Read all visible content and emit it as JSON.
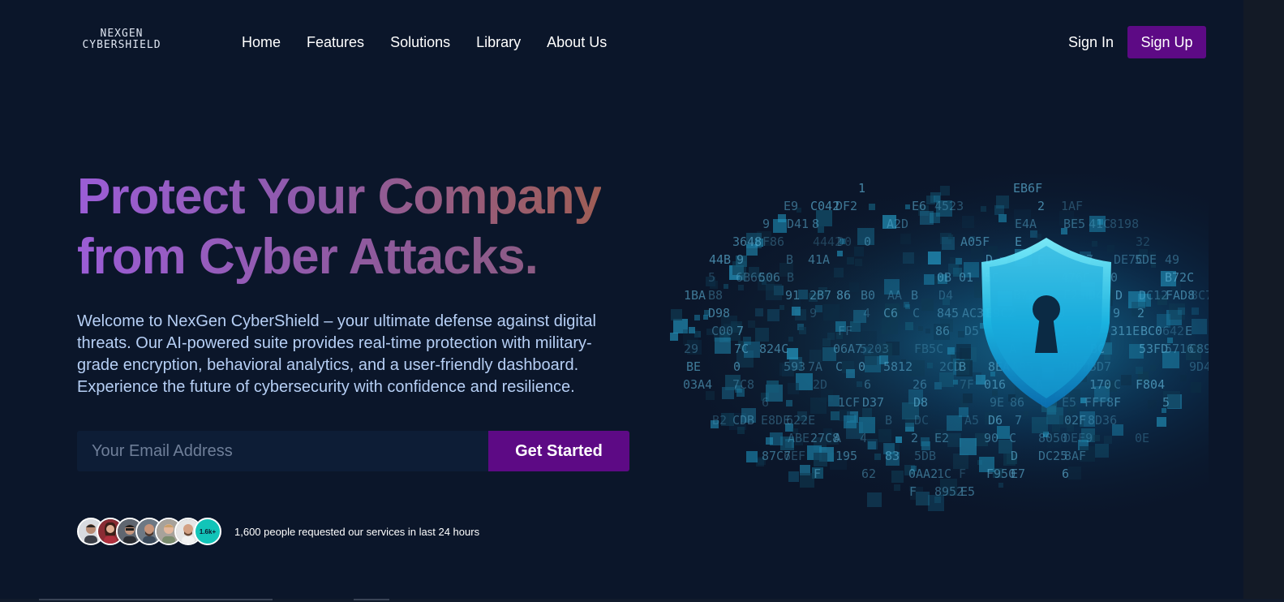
{
  "brand": {
    "logo_line1": "NEXGEN",
    "logo_line2": "CYBERSHIELD"
  },
  "nav": {
    "items": [
      {
        "label": "Home"
      },
      {
        "label": "Features"
      },
      {
        "label": "Solutions"
      },
      {
        "label": "Library"
      },
      {
        "label": "About Us"
      }
    ],
    "sign_in": "Sign In",
    "sign_up": "Sign Up"
  },
  "hero": {
    "headline_line1": "Protect Your Company",
    "headline_line2": "from Cyber Attacks.",
    "description": "Welcome to NexGen CyberShield – your ultimate defense against digital threats. Our AI-powered suite provides real-time protection with military-grade encryption, behavioral analytics, and a user-friendly dashboard. Experience the future of cybersecurity with confidence and resilience.",
    "email_placeholder": "Your Email Address",
    "cta": "Get Started",
    "avatar_count": "1.6k+",
    "social_proof": "1,600 people requested our services in last 24 hours"
  },
  "colors": {
    "background": "#0b162a",
    "accent": "#5d0a85",
    "text_blue": "#b6cff5",
    "badge": "#12c4b8"
  },
  "icons": {
    "hero_art": "shield-lock-icon"
  }
}
